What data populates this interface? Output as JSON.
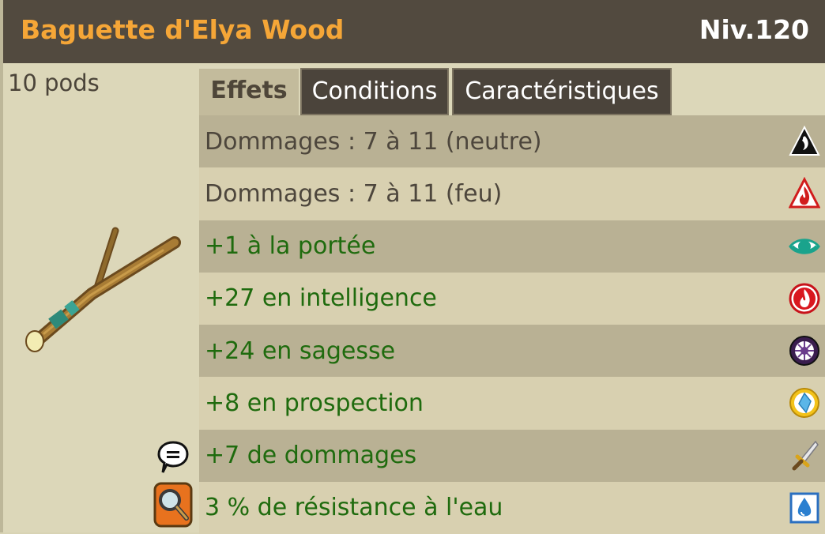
{
  "item": {
    "name": "Baguette d'Elya Wood",
    "level": "Niv.120",
    "weight": "10 pods"
  },
  "tabs": [
    {
      "label": "Effets",
      "active": true
    },
    {
      "label": "Conditions",
      "active": false
    },
    {
      "label": "Caractéristiques",
      "active": false
    }
  ],
  "effects": [
    {
      "text": "Dommages : 7 à 11 (neutre)",
      "color": "gray",
      "icon": "neutral-element-icon"
    },
    {
      "text": "Dommages : 7 à 11 (feu)",
      "color": "gray",
      "icon": "fire-element-icon"
    },
    {
      "text": "+1 à la portée",
      "color": "green",
      "icon": "range-eye-icon"
    },
    {
      "text": "+27 en intelligence",
      "color": "green",
      "icon": "intelligence-fire-icon"
    },
    {
      "text": "+24 en sagesse",
      "color": "green",
      "icon": "wisdom-icon"
    },
    {
      "text": "+8 en prospection",
      "color": "green",
      "icon": "prospecting-icon"
    },
    {
      "text": "+7 de dommages",
      "color": "green",
      "icon": "damage-sword-icon"
    },
    {
      "text": "3 % de résistance à l'eau",
      "color": "green",
      "icon": "water-resistance-icon"
    }
  ],
  "colors": {
    "header_bg": "#524a3f",
    "title": "#f5a637",
    "bonus_text": "#1f6b0e",
    "damage_text": "#4d463c"
  }
}
